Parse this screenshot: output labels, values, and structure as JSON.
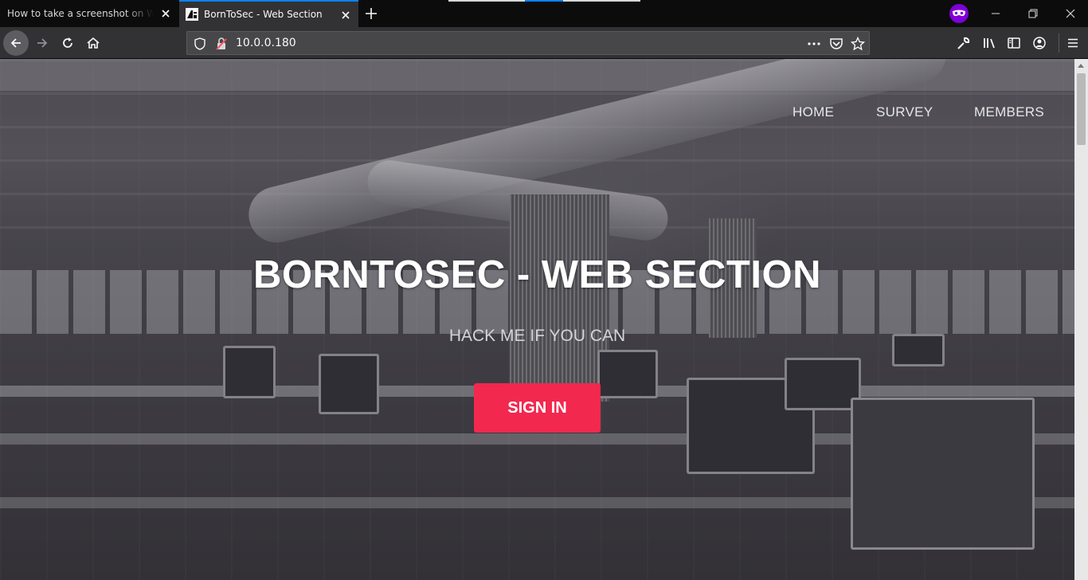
{
  "browser": {
    "tabs": [
      {
        "title": "How to take a screenshot on Windo",
        "active": false
      },
      {
        "title": "BornToSec - Web Section",
        "active": true
      }
    ],
    "url": "10.0.0.180"
  },
  "page": {
    "nav": [
      "HOME",
      "SURVEY",
      "MEMBERS"
    ],
    "title": "BORNTOSEC - WEB SECTION",
    "subtitle": "HACK ME IF YOU CAN",
    "signin_label": "SIGN IN"
  },
  "colors": {
    "accent": "#f2284f",
    "active_tab_indicator": "#0a84ff",
    "private_browsing": "#8000d7"
  },
  "icons": [
    "close-icon",
    "plus-icon",
    "private-mask-icon",
    "back-arrow-icon",
    "forward-arrow-icon",
    "reload-icon",
    "home-icon",
    "shield-icon",
    "insecure-lock-icon",
    "more-icon",
    "pocket-icon",
    "star-icon",
    "wrench-icon",
    "library-icon",
    "sidebar-icon",
    "account-icon",
    "menu-icon"
  ]
}
